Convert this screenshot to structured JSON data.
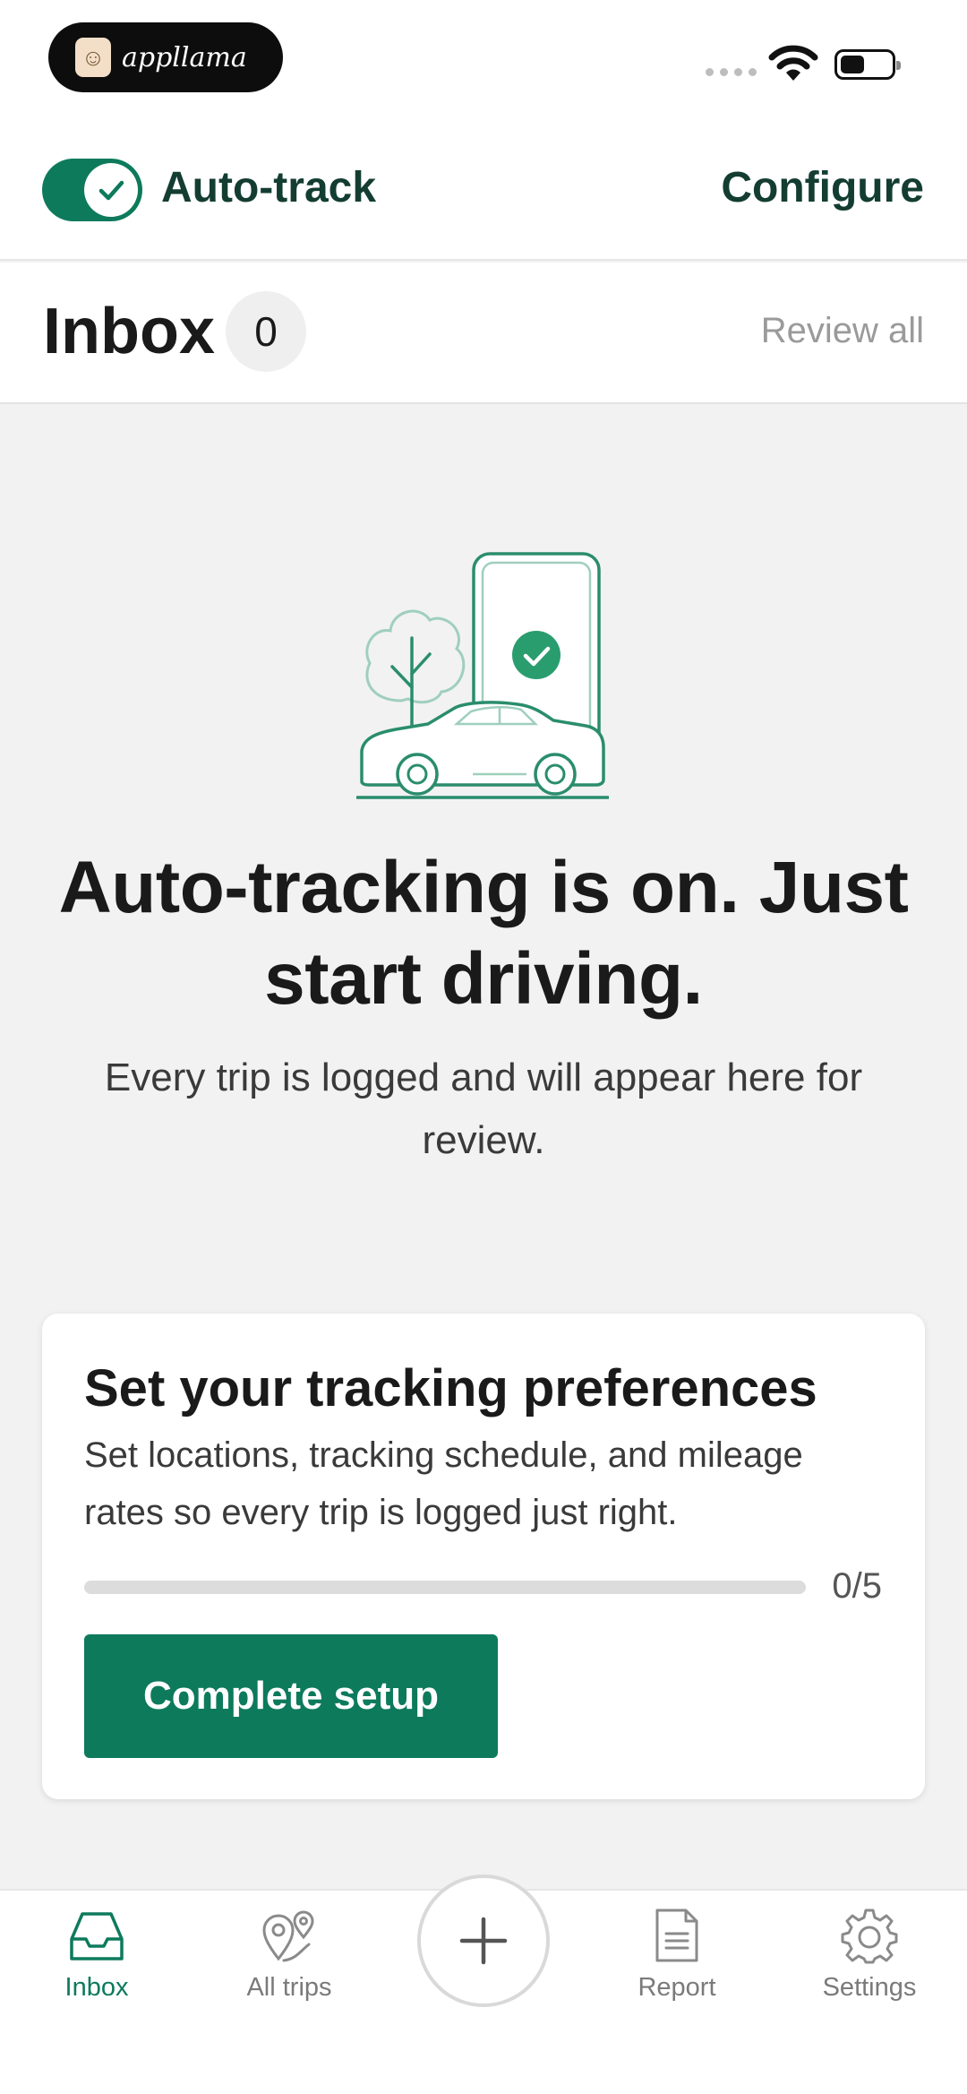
{
  "status_bar": {
    "app_brand": "appllama"
  },
  "header": {
    "toggle_label": "Auto-track",
    "toggle_on": true,
    "configure_label": "Configure"
  },
  "inbox": {
    "title": "Inbox",
    "count": "0",
    "review_all_label": "Review all"
  },
  "empty_state": {
    "title": "Auto-tracking is on. Just start driving.",
    "subtitle": "Every trip is logged and will appear here for review."
  },
  "setup_card": {
    "title": "Set your tracking preferences",
    "description": "Set locations, tracking schedule, and mileage rates so every trip is logged just right.",
    "progress_label": "0/5",
    "progress_fraction": 0,
    "button_label": "Complete setup"
  },
  "tab_bar": {
    "tabs": [
      {
        "label": "Inbox",
        "icon": "inbox-tray-icon",
        "active": true
      },
      {
        "label": "All trips",
        "icon": "map-pins-icon",
        "active": false
      },
      {
        "label": "Report",
        "icon": "document-icon",
        "active": false
      },
      {
        "label": "Settings",
        "icon": "gear-icon",
        "active": false
      }
    ],
    "add_icon": "plus-icon"
  },
  "colors": {
    "accent": "#0d7a5c",
    "accent_dark_text": "#143d32",
    "background": "#f2f2f2"
  }
}
